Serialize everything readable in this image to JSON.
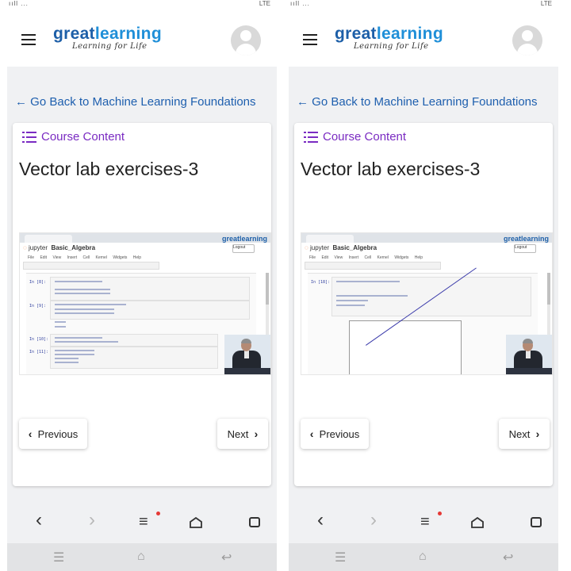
{
  "screens": [
    {
      "status_left": "ııll ...",
      "status_right": "LTE",
      "header": {
        "logo_main_a": "great",
        "logo_main_b": "learning",
        "logo_tagline": "Learning for Life"
      },
      "back_link": "← Go Back to Machine Learning Foundations",
      "course_content_label": "Course Content",
      "lesson_title": "Vector lab exercises-3",
      "video": {
        "jupyter_label": "jupyter",
        "notebook_name": "Basic_Algebra",
        "logout": "Logout",
        "menu": "File Edit View Insert Cell Kernel Widgets Help",
        "site_logo": "greatlearning",
        "prompts": [
          "In [8]:",
          "In [9]:",
          "In [10]:",
          "In [11]:"
        ]
      },
      "prev_label": "Previous",
      "next_label": "Next"
    },
    {
      "status_left": "ııll ...",
      "status_right": "LTE",
      "header": {
        "logo_main_a": "great",
        "logo_main_b": "learning",
        "logo_tagline": "Learning for Life"
      },
      "back_link": "← Go Back to Machine Learning Foundations",
      "course_content_label": "Course Content",
      "lesson_title": "Vector lab exercises-3",
      "video": {
        "jupyter_label": "jupyter",
        "notebook_name": "Basic_Algebra",
        "logout": "Logout",
        "menu": "File Edit View Insert Cell Kernel Widgets Help",
        "site_logo": "greatlearning",
        "prompts": [
          "In [18]:"
        ]
      },
      "prev_label": "Previous",
      "next_label": "Next"
    }
  ],
  "bottom_nav_icons": [
    "back-icon",
    "forward-icon",
    "menu-icon",
    "home-icon",
    "mask-icon"
  ],
  "colors": {
    "brand_blue": "#1d5fa8",
    "purple": "#7a2bc2",
    "link_blue": "#1e5fae",
    "notification_red": "#e53935"
  }
}
